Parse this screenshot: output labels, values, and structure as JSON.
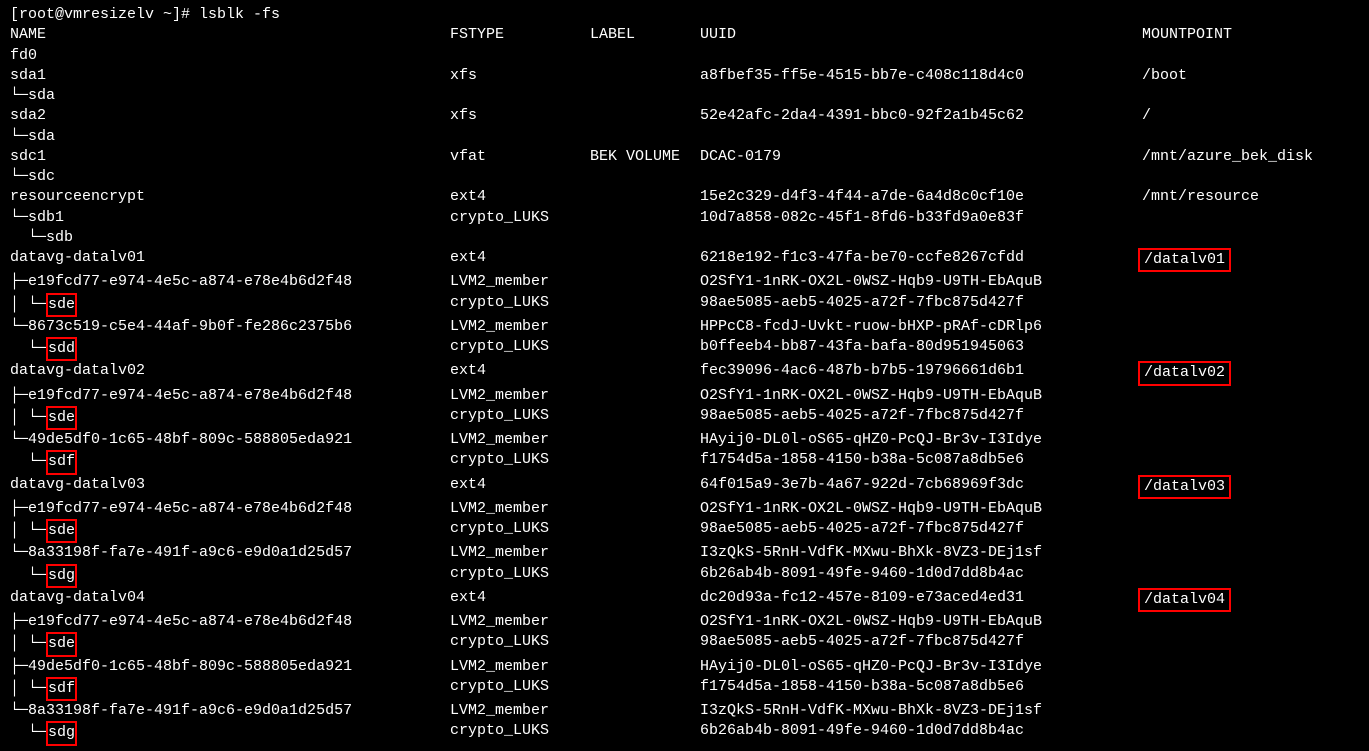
{
  "prompt": "[root@vmresizelv ~]# lsblk -fs",
  "columns": {
    "name": "NAME",
    "fstype": "FSTYPE",
    "label": "LABEL",
    "uuid": "UUID",
    "mount": "MOUNTPOINT"
  },
  "rows": [
    {
      "prefix": "",
      "name": "fd0",
      "fstype": "",
      "label": "",
      "uuid": "",
      "mount": "",
      "high_name": false,
      "high_mount": false
    },
    {
      "prefix": "",
      "name": "sda1",
      "fstype": "xfs",
      "label": "",
      "uuid": "a8fbef35-ff5e-4515-bb7e-c408c118d4c0",
      "mount": "/boot",
      "high_name": false,
      "high_mount": false
    },
    {
      "prefix": "└─",
      "name": "sda",
      "fstype": "",
      "label": "",
      "uuid": "",
      "mount": "",
      "high_name": false,
      "high_mount": false
    },
    {
      "prefix": "",
      "name": "sda2",
      "fstype": "xfs",
      "label": "",
      "uuid": "52e42afc-2da4-4391-bbc0-92f2a1b45c62",
      "mount": "/",
      "high_name": false,
      "high_mount": false
    },
    {
      "prefix": "└─",
      "name": "sda",
      "fstype": "",
      "label": "",
      "uuid": "",
      "mount": "",
      "high_name": false,
      "high_mount": false
    },
    {
      "prefix": "",
      "name": "sdc1",
      "fstype": "vfat",
      "label": "BEK VOLUME",
      "uuid": "DCAC-0179",
      "mount": "/mnt/azure_bek_disk",
      "high_name": false,
      "high_mount": false
    },
    {
      "prefix": "└─",
      "name": "sdc",
      "fstype": "",
      "label": "",
      "uuid": "",
      "mount": "",
      "high_name": false,
      "high_mount": false
    },
    {
      "prefix": "",
      "name": "resourceencrypt",
      "fstype": "ext4",
      "label": "",
      "uuid": "15e2c329-d4f3-4f44-a7de-6a4d8c0cf10e",
      "mount": "/mnt/resource",
      "high_name": false,
      "high_mount": false
    },
    {
      "prefix": "└─",
      "name": "sdb1",
      "fstype": "crypto_LUKS",
      "label": "",
      "uuid": "10d7a858-082c-45f1-8fd6-b33fd9a0e83f",
      "mount": "",
      "high_name": false,
      "high_mount": false
    },
    {
      "prefix": "  └─",
      "name": "sdb",
      "fstype": "",
      "label": "",
      "uuid": "",
      "mount": "",
      "high_name": false,
      "high_mount": false
    },
    {
      "prefix": "",
      "name": "datavg-datalv01",
      "fstype": "ext4",
      "label": "",
      "uuid": "6218e192-f1c3-47fa-be70-ccfe8267cfdd",
      "mount": "/datalv01",
      "high_name": false,
      "high_mount": true
    },
    {
      "prefix": "├─",
      "name": "e19fcd77-e974-4e5c-a874-e78e4b6d2f48",
      "fstype": "LVM2_member",
      "label": "",
      "uuid": "O2SfY1-1nRK-OX2L-0WSZ-Hqb9-U9TH-EbAquB",
      "mount": "",
      "high_name": false,
      "high_mount": false
    },
    {
      "prefix": "│ └─",
      "name": "sde",
      "fstype": "crypto_LUKS",
      "label": "",
      "uuid": "98ae5085-aeb5-4025-a72f-7fbc875d427f",
      "mount": "",
      "high_name": true,
      "high_mount": false
    },
    {
      "prefix": "└─",
      "name": "8673c519-c5e4-44af-9b0f-fe286c2375b6",
      "fstype": "LVM2_member",
      "label": "",
      "uuid": "HPPcC8-fcdJ-Uvkt-ruow-bHXP-pRAf-cDRlp6",
      "mount": "",
      "high_name": false,
      "high_mount": false
    },
    {
      "prefix": "  └─",
      "name": "sdd",
      "fstype": "crypto_LUKS",
      "label": "",
      "uuid": "b0ffeeb4-bb87-43fa-bafa-80d951945063",
      "mount": "",
      "high_name": true,
      "high_mount": false
    },
    {
      "prefix": "",
      "name": "datavg-datalv02",
      "fstype": "ext4",
      "label": "",
      "uuid": "fec39096-4ac6-487b-b7b5-19796661d6b1",
      "mount": "/datalv02",
      "high_name": false,
      "high_mount": true
    },
    {
      "prefix": "├─",
      "name": "e19fcd77-e974-4e5c-a874-e78e4b6d2f48",
      "fstype": "LVM2_member",
      "label": "",
      "uuid": "O2SfY1-1nRK-OX2L-0WSZ-Hqb9-U9TH-EbAquB",
      "mount": "",
      "high_name": false,
      "high_mount": false
    },
    {
      "prefix": "│ └─",
      "name": "sde",
      "fstype": "crypto_LUKS",
      "label": "",
      "uuid": "98ae5085-aeb5-4025-a72f-7fbc875d427f",
      "mount": "",
      "high_name": true,
      "high_mount": false
    },
    {
      "prefix": "└─",
      "name": "49de5df0-1c65-48bf-809c-588805eda921",
      "fstype": "LVM2_member",
      "label": "",
      "uuid": "HAyij0-DL0l-oS65-qHZ0-PcQJ-Br3v-I3Idye",
      "mount": "",
      "high_name": false,
      "high_mount": false
    },
    {
      "prefix": "  └─",
      "name": "sdf",
      "fstype": "crypto_LUKS",
      "label": "",
      "uuid": "f1754d5a-1858-4150-b38a-5c087a8db5e6",
      "mount": "",
      "high_name": true,
      "high_mount": false
    },
    {
      "prefix": "",
      "name": "datavg-datalv03",
      "fstype": "ext4",
      "label": "",
      "uuid": "64f015a9-3e7b-4a67-922d-7cb68969f3dc",
      "mount": "/datalv03",
      "high_name": false,
      "high_mount": true
    },
    {
      "prefix": "├─",
      "name": "e19fcd77-e974-4e5c-a874-e78e4b6d2f48",
      "fstype": "LVM2_member",
      "label": "",
      "uuid": "O2SfY1-1nRK-OX2L-0WSZ-Hqb9-U9TH-EbAquB",
      "mount": "",
      "high_name": false,
      "high_mount": false
    },
    {
      "prefix": "│ └─",
      "name": "sde",
      "fstype": "crypto_LUKS",
      "label": "",
      "uuid": "98ae5085-aeb5-4025-a72f-7fbc875d427f",
      "mount": "",
      "high_name": true,
      "high_mount": false
    },
    {
      "prefix": "└─",
      "name": "8a33198f-fa7e-491f-a9c6-e9d0a1d25d57",
      "fstype": "LVM2_member",
      "label": "",
      "uuid": "I3zQkS-5RnH-VdfK-MXwu-BhXk-8VZ3-DEj1sf",
      "mount": "",
      "high_name": false,
      "high_mount": false
    },
    {
      "prefix": "  └─",
      "name": "sdg",
      "fstype": "crypto_LUKS",
      "label": "",
      "uuid": "6b26ab4b-8091-49fe-9460-1d0d7dd8b4ac",
      "mount": "",
      "high_name": true,
      "high_mount": false
    },
    {
      "prefix": "",
      "name": "datavg-datalv04",
      "fstype": "ext4",
      "label": "",
      "uuid": "dc20d93a-fc12-457e-8109-e73aced4ed31",
      "mount": "/datalv04",
      "high_name": false,
      "high_mount": true
    },
    {
      "prefix": "├─",
      "name": "e19fcd77-e974-4e5c-a874-e78e4b6d2f48",
      "fstype": "LVM2_member",
      "label": "",
      "uuid": "O2SfY1-1nRK-OX2L-0WSZ-Hqb9-U9TH-EbAquB",
      "mount": "",
      "high_name": false,
      "high_mount": false
    },
    {
      "prefix": "│ └─",
      "name": "sde",
      "fstype": "crypto_LUKS",
      "label": "",
      "uuid": "98ae5085-aeb5-4025-a72f-7fbc875d427f",
      "mount": "",
      "high_name": true,
      "high_mount": false
    },
    {
      "prefix": "├─",
      "name": "49de5df0-1c65-48bf-809c-588805eda921",
      "fstype": "LVM2_member",
      "label": "",
      "uuid": "HAyij0-DL0l-oS65-qHZ0-PcQJ-Br3v-I3Idye",
      "mount": "",
      "high_name": false,
      "high_mount": false
    },
    {
      "prefix": "│ └─",
      "name": "sdf",
      "fstype": "crypto_LUKS",
      "label": "",
      "uuid": "f1754d5a-1858-4150-b38a-5c087a8db5e6",
      "mount": "",
      "high_name": true,
      "high_mount": false
    },
    {
      "prefix": "└─",
      "name": "8a33198f-fa7e-491f-a9c6-e9d0a1d25d57",
      "fstype": "LVM2_member",
      "label": "",
      "uuid": "I3zQkS-5RnH-VdfK-MXwu-BhXk-8VZ3-DEj1sf",
      "mount": "",
      "high_name": false,
      "high_mount": false
    },
    {
      "prefix": "  └─",
      "name": "sdg",
      "fstype": "crypto_LUKS",
      "label": "",
      "uuid": "6b26ab4b-8091-49fe-9460-1d0d7dd8b4ac",
      "mount": "",
      "high_name": true,
      "high_mount": false
    }
  ]
}
